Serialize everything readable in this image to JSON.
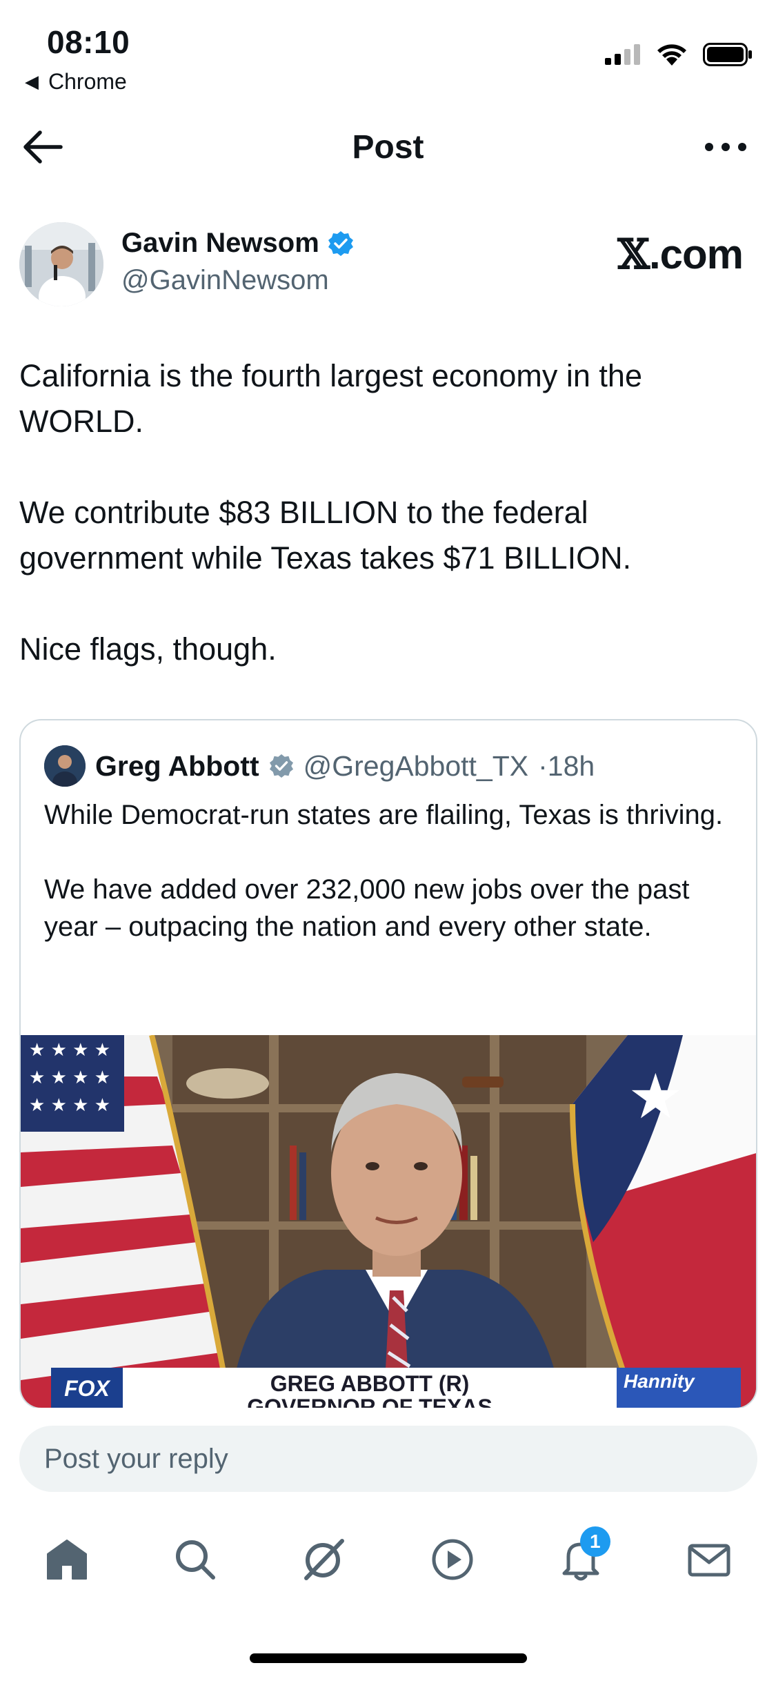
{
  "status_bar": {
    "time": "08:10",
    "back_app": "Chrome"
  },
  "nav": {
    "title": "Post",
    "back_icon": "arrow-left-icon",
    "more_icon": "more-horizontal-icon"
  },
  "post": {
    "author_name": "Gavin Newsom",
    "author_handle": "@GavinNewsom",
    "verified": true,
    "watermark": "X.com",
    "text_lines": [
      "California is the fourth largest economy in the WORLD.",
      "We contribute $83 BILLION to the federal government while Texas takes $71 BILLION.",
      "Nice flags, though."
    ]
  },
  "quoted_post": {
    "author_name": "Greg Abbott",
    "author_handle": "@GregAbbott_TX",
    "time": "·18h",
    "text_lines": [
      "While Democrat-run states are flailing, Texas is thriving.",
      "We have added over 232,000 new jobs over the past year – outpacing the nation and every other state."
    ],
    "media": {
      "chyron_line1": "GREG ABBOTT (R)",
      "chyron_line2": "GOVERNOR OF TEXAS",
      "network": "FOX",
      "show": "Hannity"
    }
  },
  "reply": {
    "placeholder": "Post your reply"
  },
  "tabbar": {
    "items": [
      "home-icon",
      "search-icon",
      "grok-icon",
      "video-icon",
      "notifications-icon",
      "messages-icon"
    ],
    "notification_count": "1"
  },
  "colors": {
    "accent": "#1d9bf0",
    "text": "#0f1419",
    "secondary": "#536471",
    "border": "#cfd9de"
  }
}
